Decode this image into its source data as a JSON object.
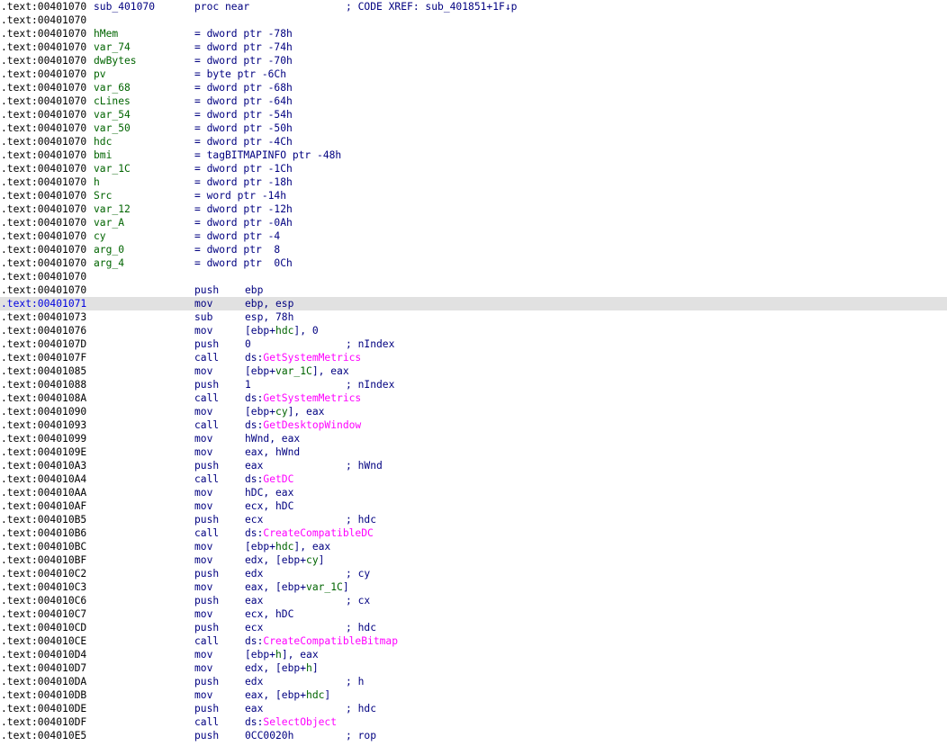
{
  "header": {
    "address": ".text:00401070",
    "proc_name": "sub_401070",
    "proc_decl": "proc near",
    "xref_comment": "; CODE XREF: sub_401851+1F↓p"
  },
  "colors": {
    "background": "#ffffff",
    "text": "#000080",
    "variable_name": "#006400",
    "api_name": "#ff00ff",
    "selected_row": "#e1e1e1",
    "selected_address": "#0000e0"
  },
  "vars": [
    {
      "addr": ".text:00401070",
      "name": "hMem",
      "def": "= dword ptr -78h"
    },
    {
      "addr": ".text:00401070",
      "name": "var_74",
      "def": "= dword ptr -74h"
    },
    {
      "addr": ".text:00401070",
      "name": "dwBytes",
      "def": "= dword ptr -70h"
    },
    {
      "addr": ".text:00401070",
      "name": "pv",
      "def": "= byte ptr -6Ch"
    },
    {
      "addr": ".text:00401070",
      "name": "var_68",
      "def": "= dword ptr -68h"
    },
    {
      "addr": ".text:00401070",
      "name": "cLines",
      "def": "= dword ptr -64h"
    },
    {
      "addr": ".text:00401070",
      "name": "var_54",
      "def": "= dword ptr -54h"
    },
    {
      "addr": ".text:00401070",
      "name": "var_50",
      "def": "= dword ptr -50h"
    },
    {
      "addr": ".text:00401070",
      "name": "hdc",
      "def": "= dword ptr -4Ch"
    },
    {
      "addr": ".text:00401070",
      "name": "bmi",
      "def": "= tagBITMAPINFO ptr -48h"
    },
    {
      "addr": ".text:00401070",
      "name": "var_1C",
      "def": "= dword ptr -1Ch"
    },
    {
      "addr": ".text:00401070",
      "name": "h",
      "def": "= dword ptr -18h"
    },
    {
      "addr": ".text:00401070",
      "name": "Src",
      "def": "= word ptr -14h"
    },
    {
      "addr": ".text:00401070",
      "name": "var_12",
      "def": "= dword ptr -12h"
    },
    {
      "addr": ".text:00401070",
      "name": "var_A",
      "def": "= dword ptr -0Ah"
    },
    {
      "addr": ".text:00401070",
      "name": "cy",
      "def": "= dword ptr -4"
    },
    {
      "addr": ".text:00401070",
      "name": "arg_0",
      "def": "= dword ptr  8"
    },
    {
      "addr": ".text:00401070",
      "name": "arg_4",
      "def": "= dword ptr  0Ch"
    }
  ],
  "blank_addr": ".text:00401070",
  "instructions": [
    {
      "addr": ".text:00401070",
      "mnemonic": "push",
      "parts": [
        {
          "t": "ebp",
          "k": "plain"
        }
      ],
      "comment": ""
    },
    {
      "addr": ".text:00401071",
      "mnemonic": "mov",
      "parts": [
        {
          "t": "ebp, esp",
          "k": "plain"
        }
      ],
      "comment": "",
      "selected": true
    },
    {
      "addr": ".text:00401073",
      "mnemonic": "sub",
      "parts": [
        {
          "t": "esp, 78h",
          "k": "plain"
        }
      ],
      "comment": ""
    },
    {
      "addr": ".text:00401076",
      "mnemonic": "mov",
      "parts": [
        {
          "t": "[ebp+",
          "k": "plain"
        },
        {
          "t": "hdc",
          "k": "var"
        },
        {
          "t": "], 0",
          "k": "plain"
        }
      ],
      "comment": ""
    },
    {
      "addr": ".text:0040107D",
      "mnemonic": "push",
      "parts": [
        {
          "t": "0",
          "k": "plain"
        }
      ],
      "comment": "; nIndex"
    },
    {
      "addr": ".text:0040107F",
      "mnemonic": "call",
      "parts": [
        {
          "t": "ds:",
          "k": "plain"
        },
        {
          "t": "GetSystemMetrics",
          "k": "api"
        }
      ],
      "comment": ""
    },
    {
      "addr": ".text:00401085",
      "mnemonic": "mov",
      "parts": [
        {
          "t": "[ebp+",
          "k": "plain"
        },
        {
          "t": "var_1C",
          "k": "var"
        },
        {
          "t": "], eax",
          "k": "plain"
        }
      ],
      "comment": ""
    },
    {
      "addr": ".text:00401088",
      "mnemonic": "push",
      "parts": [
        {
          "t": "1",
          "k": "plain"
        }
      ],
      "comment": "; nIndex"
    },
    {
      "addr": ".text:0040108A",
      "mnemonic": "call",
      "parts": [
        {
          "t": "ds:",
          "k": "plain"
        },
        {
          "t": "GetSystemMetrics",
          "k": "api"
        }
      ],
      "comment": ""
    },
    {
      "addr": ".text:00401090",
      "mnemonic": "mov",
      "parts": [
        {
          "t": "[ebp+",
          "k": "plain"
        },
        {
          "t": "cy",
          "k": "var"
        },
        {
          "t": "], eax",
          "k": "plain"
        }
      ],
      "comment": ""
    },
    {
      "addr": ".text:00401093",
      "mnemonic": "call",
      "parts": [
        {
          "t": "ds:",
          "k": "plain"
        },
        {
          "t": "GetDesktopWindow",
          "k": "api"
        }
      ],
      "comment": ""
    },
    {
      "addr": ".text:00401099",
      "mnemonic": "mov",
      "parts": [
        {
          "t": "hWnd, eax",
          "k": "plain"
        }
      ],
      "comment": ""
    },
    {
      "addr": ".text:0040109E",
      "mnemonic": "mov",
      "parts": [
        {
          "t": "eax, hWnd",
          "k": "plain"
        }
      ],
      "comment": ""
    },
    {
      "addr": ".text:004010A3",
      "mnemonic": "push",
      "parts": [
        {
          "t": "eax",
          "k": "plain"
        }
      ],
      "comment": "; hWnd"
    },
    {
      "addr": ".text:004010A4",
      "mnemonic": "call",
      "parts": [
        {
          "t": "ds:",
          "k": "plain"
        },
        {
          "t": "GetDC",
          "k": "api"
        }
      ],
      "comment": ""
    },
    {
      "addr": ".text:004010AA",
      "mnemonic": "mov",
      "parts": [
        {
          "t": "hDC, eax",
          "k": "plain"
        }
      ],
      "comment": ""
    },
    {
      "addr": ".text:004010AF",
      "mnemonic": "mov",
      "parts": [
        {
          "t": "ecx, hDC",
          "k": "plain"
        }
      ],
      "comment": ""
    },
    {
      "addr": ".text:004010B5",
      "mnemonic": "push",
      "parts": [
        {
          "t": "ecx",
          "k": "plain"
        }
      ],
      "comment": "; hdc"
    },
    {
      "addr": ".text:004010B6",
      "mnemonic": "call",
      "parts": [
        {
          "t": "ds:",
          "k": "plain"
        },
        {
          "t": "CreateCompatibleDC",
          "k": "api"
        }
      ],
      "comment": ""
    },
    {
      "addr": ".text:004010BC",
      "mnemonic": "mov",
      "parts": [
        {
          "t": "[ebp+",
          "k": "plain"
        },
        {
          "t": "hdc",
          "k": "var"
        },
        {
          "t": "], eax",
          "k": "plain"
        }
      ],
      "comment": ""
    },
    {
      "addr": ".text:004010BF",
      "mnemonic": "mov",
      "parts": [
        {
          "t": "edx, [ebp+",
          "k": "plain"
        },
        {
          "t": "cy",
          "k": "var"
        },
        {
          "t": "]",
          "k": "plain"
        }
      ],
      "comment": ""
    },
    {
      "addr": ".text:004010C2",
      "mnemonic": "push",
      "parts": [
        {
          "t": "edx",
          "k": "plain"
        }
      ],
      "comment": "; cy"
    },
    {
      "addr": ".text:004010C3",
      "mnemonic": "mov",
      "parts": [
        {
          "t": "eax, [ebp+",
          "k": "plain"
        },
        {
          "t": "var_1C",
          "k": "var"
        },
        {
          "t": "]",
          "k": "plain"
        }
      ],
      "comment": ""
    },
    {
      "addr": ".text:004010C6",
      "mnemonic": "push",
      "parts": [
        {
          "t": "eax",
          "k": "plain"
        }
      ],
      "comment": "; cx"
    },
    {
      "addr": ".text:004010C7",
      "mnemonic": "mov",
      "parts": [
        {
          "t": "ecx, hDC",
          "k": "plain"
        }
      ],
      "comment": ""
    },
    {
      "addr": ".text:004010CD",
      "mnemonic": "push",
      "parts": [
        {
          "t": "ecx",
          "k": "plain"
        }
      ],
      "comment": "; hdc"
    },
    {
      "addr": ".text:004010CE",
      "mnemonic": "call",
      "parts": [
        {
          "t": "ds:",
          "k": "plain"
        },
        {
          "t": "CreateCompatibleBitmap",
          "k": "api"
        }
      ],
      "comment": ""
    },
    {
      "addr": ".text:004010D4",
      "mnemonic": "mov",
      "parts": [
        {
          "t": "[ebp+",
          "k": "plain"
        },
        {
          "t": "h",
          "k": "var"
        },
        {
          "t": "], eax",
          "k": "plain"
        }
      ],
      "comment": ""
    },
    {
      "addr": ".text:004010D7",
      "mnemonic": "mov",
      "parts": [
        {
          "t": "edx, [ebp+",
          "k": "plain"
        },
        {
          "t": "h",
          "k": "var"
        },
        {
          "t": "]",
          "k": "plain"
        }
      ],
      "comment": ""
    },
    {
      "addr": ".text:004010DA",
      "mnemonic": "push",
      "parts": [
        {
          "t": "edx",
          "k": "plain"
        }
      ],
      "comment": "; h"
    },
    {
      "addr": ".text:004010DB",
      "mnemonic": "mov",
      "parts": [
        {
          "t": "eax, [ebp+",
          "k": "plain"
        },
        {
          "t": "hdc",
          "k": "var"
        },
        {
          "t": "]",
          "k": "plain"
        }
      ],
      "comment": ""
    },
    {
      "addr": ".text:004010DE",
      "mnemonic": "push",
      "parts": [
        {
          "t": "eax",
          "k": "plain"
        }
      ],
      "comment": "; hdc"
    },
    {
      "addr": ".text:004010DF",
      "mnemonic": "call",
      "parts": [
        {
          "t": "ds:",
          "k": "plain"
        },
        {
          "t": "SelectObject",
          "k": "api"
        }
      ],
      "comment": ""
    },
    {
      "addr": ".text:004010E5",
      "mnemonic": "push",
      "parts": [
        {
          "t": "0CC0020h",
          "k": "plain"
        }
      ],
      "comment": "; rop"
    }
  ]
}
